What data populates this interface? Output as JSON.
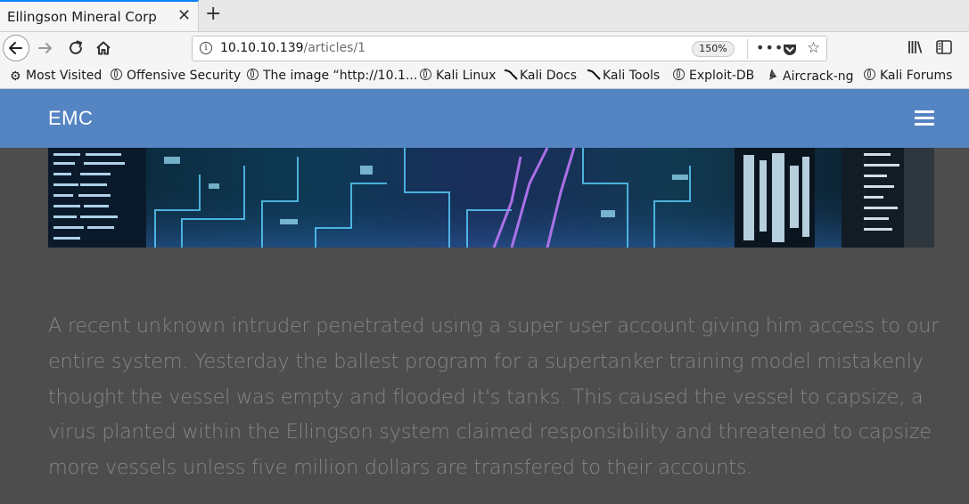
{
  "browser": {
    "tab": {
      "title": "Ellingson Mineral Corp",
      "close": "✕"
    },
    "new_tab": "+",
    "url": {
      "host": "10.10.10.139",
      "path": "/articles/1"
    },
    "zoom": "150%",
    "bookmarks": [
      {
        "label": "Most Visited",
        "icon": "gear-icon"
      },
      {
        "label": "Offensive Security",
        "icon": "globe-icon"
      },
      {
        "label": "The image “http://10.1...",
        "icon": "globe-icon"
      },
      {
        "label": "Kali Linux",
        "icon": "globe-icon"
      },
      {
        "label": "Kali Docs",
        "icon": "kali-dragon-icon"
      },
      {
        "label": "Kali Tools",
        "icon": "kali-dragon-icon"
      },
      {
        "label": "Exploit-DB",
        "icon": "globe-icon"
      },
      {
        "label": "Aircrack-ng",
        "icon": "aircrack-icon"
      },
      {
        "label": "Kali Forums",
        "icon": "globe-icon"
      }
    ]
  },
  "site": {
    "brand": "EMC",
    "article_text": "A recent unknown intruder penetrated using a super user account giving him access to our entire system. Yesterday the ballest program for a supertanker training model mistakenly thought the vessel was empty and flooded it's tanks. This caused the vessel to capsize, a virus planted within the Ellingson system claimed responsibility and threatened to capsize more vessels unless five million dollars are transfered to their accounts."
  },
  "colors": {
    "navbar": "#5584c2",
    "page_bg": "#4d4d4d",
    "text": "#858585"
  }
}
